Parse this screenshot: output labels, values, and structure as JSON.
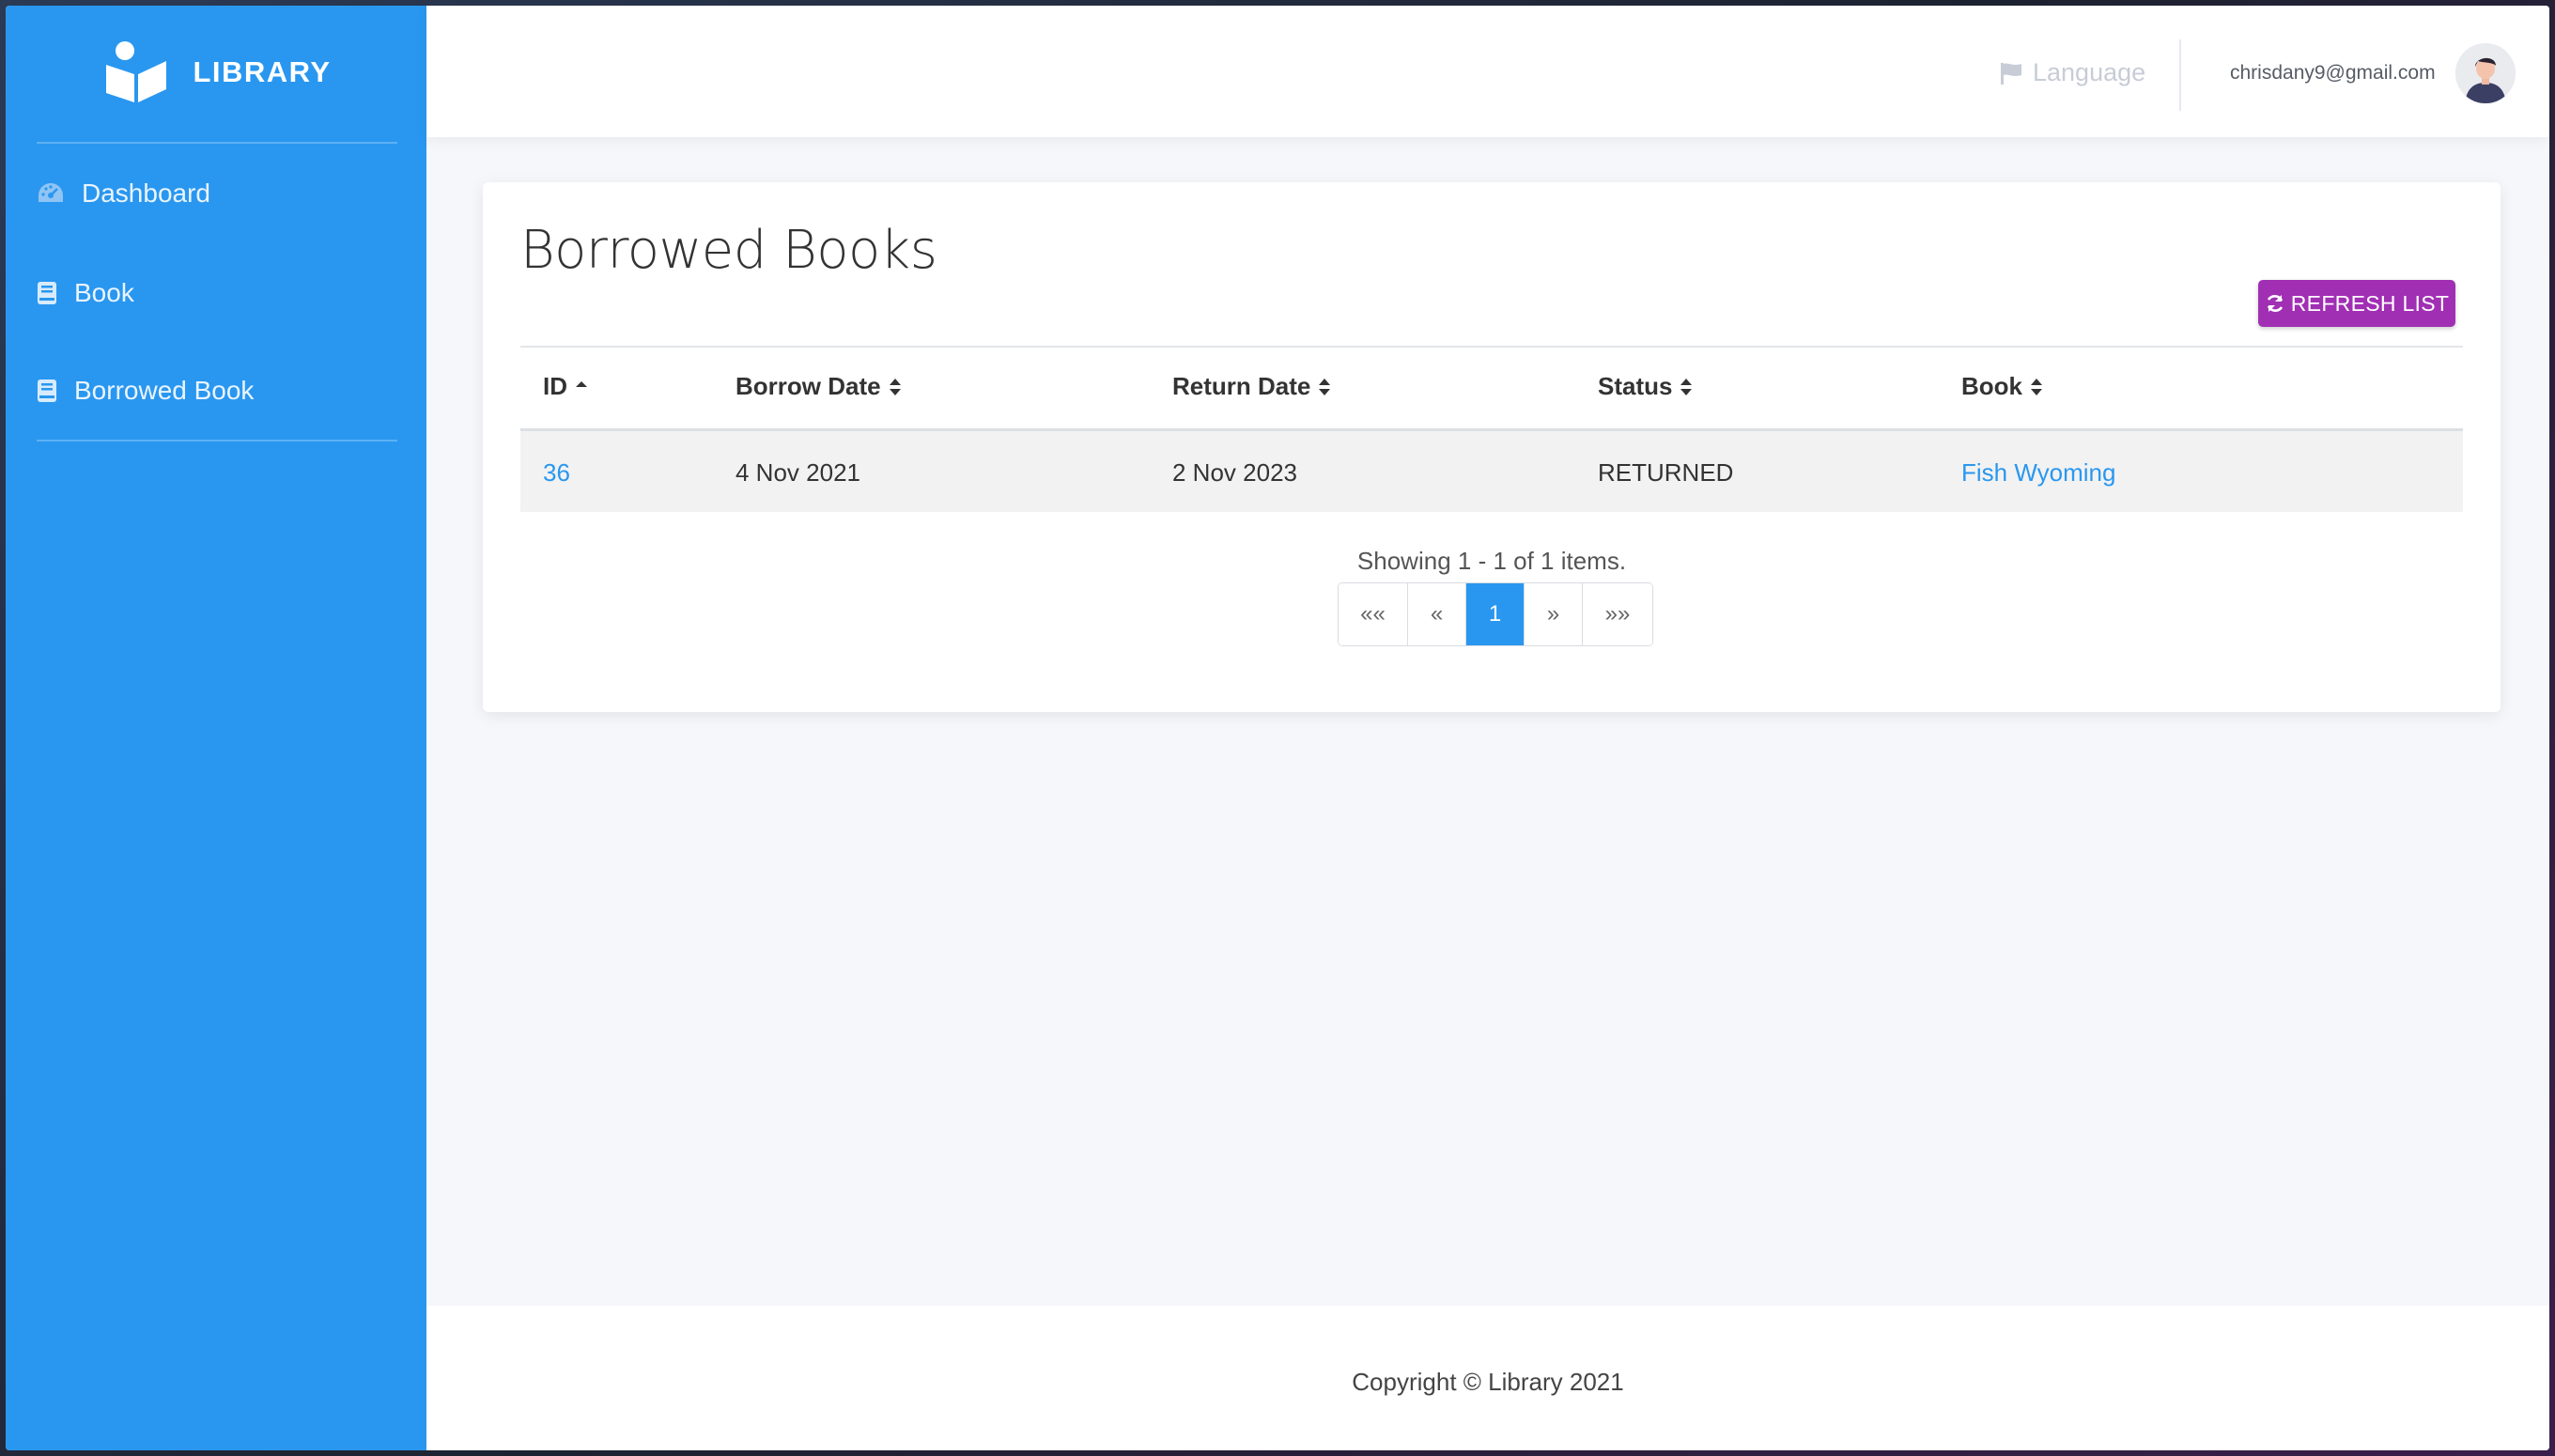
{
  "sidebar": {
    "brand": "LIBRARY",
    "items": [
      {
        "label": "Dashboard",
        "icon": "dashboard-icon"
      },
      {
        "label": "Book",
        "icon": "book-icon"
      },
      {
        "label": "Borrowed Book",
        "icon": "book-icon"
      }
    ]
  },
  "header": {
    "language_label": "Language",
    "user_email": "chrisdany9@gmail.com"
  },
  "main": {
    "title": "Borrowed Books",
    "refresh_label": "REFRESH LIST",
    "table": {
      "columns": [
        {
          "label": "ID",
          "sort": "asc"
        },
        {
          "label": "Borrow Date",
          "sort": "both"
        },
        {
          "label": "Return Date",
          "sort": "both"
        },
        {
          "label": "Status",
          "sort": "both"
        },
        {
          "label": "Book",
          "sort": "both"
        }
      ],
      "rows": [
        {
          "id": "36",
          "borrow_date": "4 Nov 2021",
          "return_date": "2 Nov 2023",
          "status": "RETURNED",
          "book": "Fish Wyoming"
        }
      ]
    },
    "summary": "Showing 1 - 1 of 1 items.",
    "pagination": {
      "first": "««",
      "prev": "«",
      "current": "1",
      "next": "»",
      "last": "»»"
    }
  },
  "footer": {
    "copyright": "Copyright © Library 2021"
  },
  "colors": {
    "sidebar": "#2997f0",
    "accent": "#a12fb4",
    "link": "#2997f0"
  }
}
